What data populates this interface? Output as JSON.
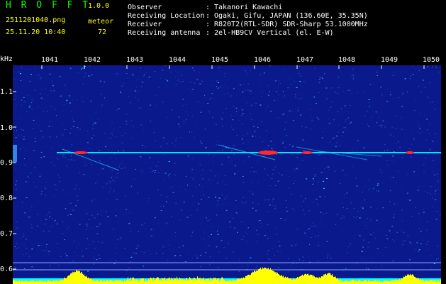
{
  "app": {
    "name": "H R O F F T",
    "version": "1.0.0"
  },
  "capture": {
    "filename": "2511201040.png",
    "datetime": "25.11.20 10:40"
  },
  "meteor": {
    "label": "meteor",
    "count": "72"
  },
  "info": [
    {
      "label": "Observer",
      "value": "Takanori Kawachi"
    },
    {
      "label": "Receiving Location",
      "value": "Ogaki, Gifu, JAPAN (136.60E, 35.35N)"
    },
    {
      "label": "Receiver",
      "value": "R820T2(RTL-SDR) SDR-Sharp 53.1000MHz"
    },
    {
      "label": "Receiving antenna",
      "value": "2el-HB9CV Vertical (el. E-W)"
    }
  ],
  "info_separator": ":",
  "axis": {
    "y_unit": "kHz",
    "x_ticks": [
      "1041",
      "1042",
      "1043",
      "1044",
      "1045",
      "1046",
      "1047",
      "1048",
      "1049",
      "1050"
    ],
    "y_ticks": [
      "1.1",
      "1.0",
      "0.9",
      "0.8",
      "0.7",
      "0.6"
    ]
  },
  "colors": {
    "background": "#000000",
    "spectrogram_base": "#0a1a8c",
    "noise": "#2f6bff",
    "echo_line": "#00e8ff",
    "echo_hot": "#ff2a2a",
    "level_bar": "#ffff00",
    "level_base": "#00ffff",
    "title_text": "#00ff00",
    "meta_text": "#ffff00"
  }
}
